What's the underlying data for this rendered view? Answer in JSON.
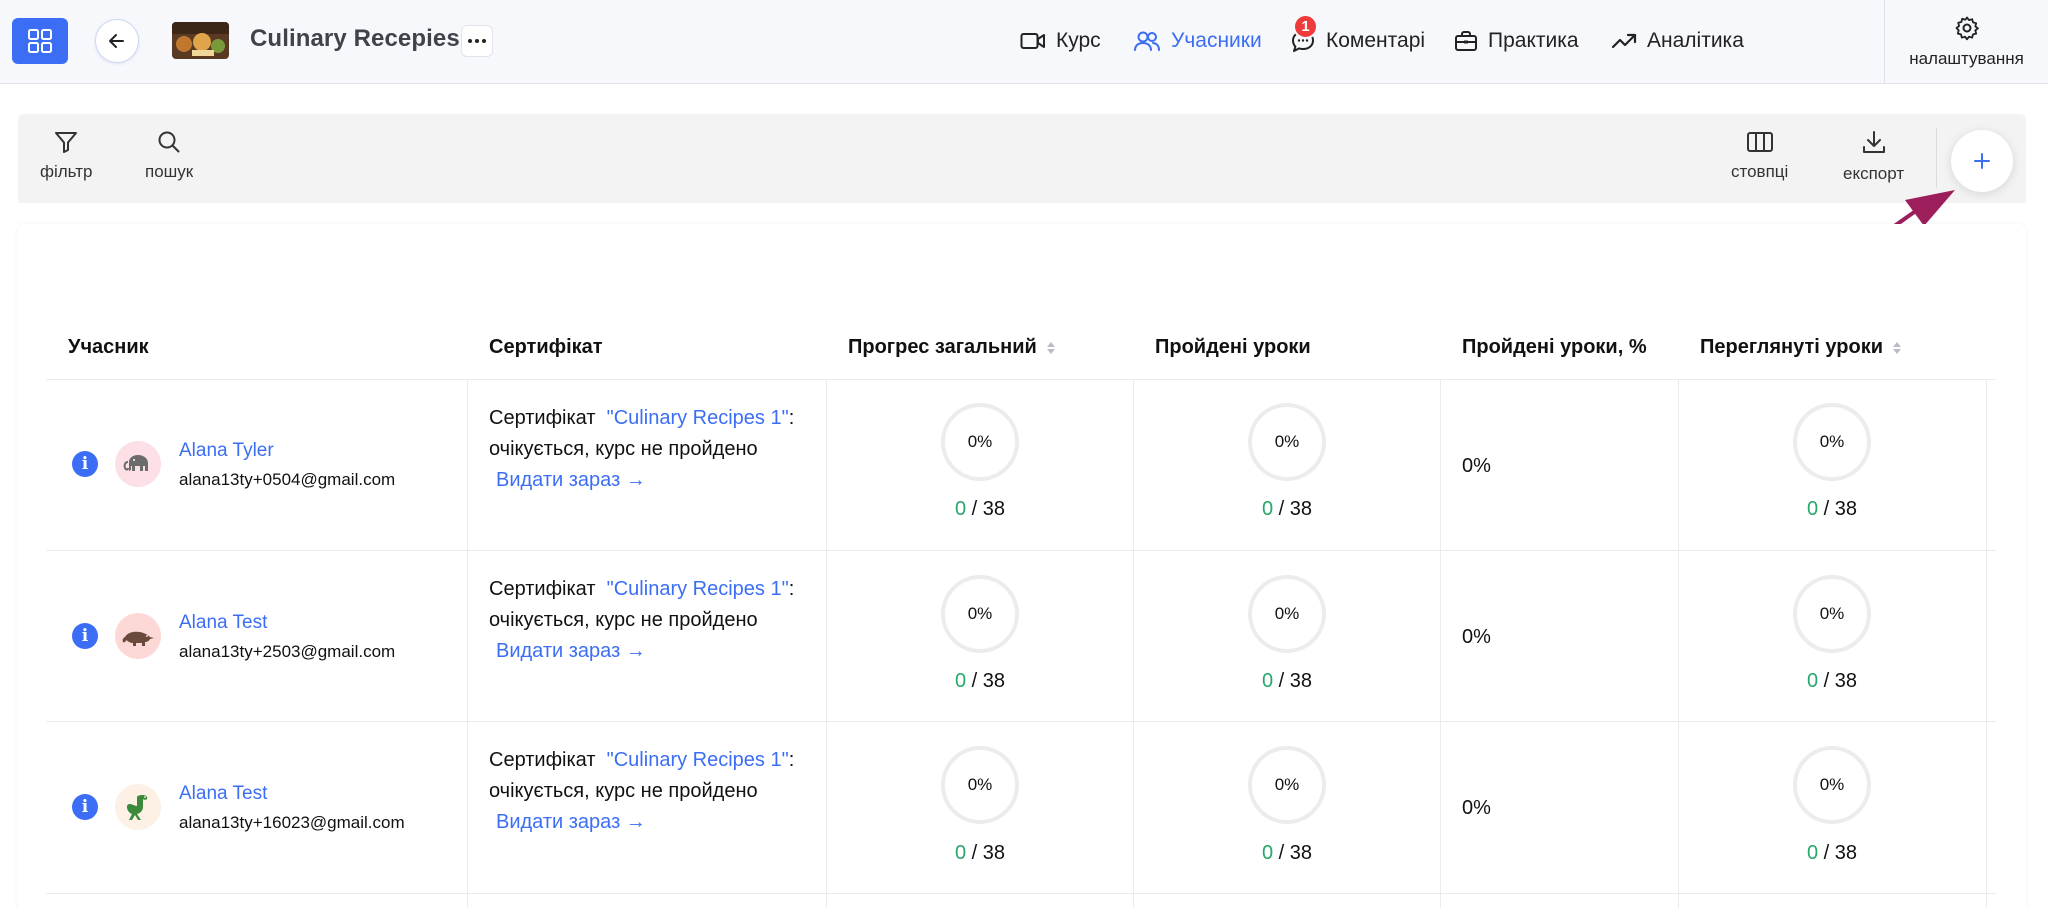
{
  "header": {
    "course_title": "Culinary Recepies",
    "nav": [
      {
        "label": "Курс",
        "icon": "video-camera-icon",
        "active": false
      },
      {
        "label": "Учасники",
        "icon": "users-icon",
        "active": true
      },
      {
        "label": "Коментарі",
        "icon": "comments-icon",
        "active": false,
        "badge": "1"
      },
      {
        "label": "Практика",
        "icon": "briefcase-icon",
        "active": false
      },
      {
        "label": "Аналітика",
        "icon": "trending-up-icon",
        "active": false
      }
    ],
    "settings_label": "налаштування"
  },
  "toolbar": {
    "filter_label": "фільтр",
    "search_label": "пошук",
    "columns_label": "стовпці",
    "export_label": "експорт"
  },
  "table": {
    "columns": [
      "Учасник",
      "Сертифікат",
      "Прогрес загальний",
      "Пройдені уроки",
      "Пройдені уроки, %",
      "Переглянуті уроки"
    ],
    "rows": [
      {
        "name": "Alana Tyler",
        "email": "alana13ty+0504@gmail.com",
        "avatar": "elephant-icon",
        "cert_prefix": "Сертифікат",
        "cert_link": "\"Culinary Recipes 1\"",
        "cert_colon": ":",
        "cert_status": "очікується, курс не пройдено",
        "cert_action": "Видати зараз →",
        "progress_pct": "0%",
        "progress_done": "0",
        "progress_total": "/ 38",
        "lessons_pct": "0%",
        "lessons_done": "0",
        "lessons_total": "/ 38",
        "lessons_percent": "0%",
        "viewed_pct": "0%",
        "viewed_done": "0",
        "viewed_total": "/ 38"
      },
      {
        "name": "Alana Test",
        "email": "alana13ty+2503@gmail.com",
        "avatar": "anteater-icon",
        "cert_prefix": "Сертифікат",
        "cert_link": "\"Culinary Recipes 1\"",
        "cert_colon": ":",
        "cert_status": "очікується, курс не пройдено",
        "cert_action": "Видати зараз →",
        "progress_pct": "0%",
        "progress_done": "0",
        "progress_total": "/ 38",
        "lessons_pct": "0%",
        "lessons_done": "0",
        "lessons_total": "/ 38",
        "lessons_percent": "0%",
        "viewed_pct": "0%",
        "viewed_done": "0",
        "viewed_total": "/ 38"
      },
      {
        "name": "Alana Test",
        "email": "alana13ty+16023@gmail.com",
        "avatar": "dinosaur-icon",
        "cert_prefix": "Сертифікат",
        "cert_link": "\"Culinary Recipes 1\"",
        "cert_colon": ":",
        "cert_status": "очікується, курс не пройдено",
        "cert_action": "Видати зараз →",
        "progress_pct": "0%",
        "progress_done": "0",
        "progress_total": "/ 38",
        "lessons_pct": "0%",
        "lessons_done": "0",
        "lessons_total": "/ 38",
        "lessons_percent": "0%",
        "viewed_pct": "0%",
        "viewed_done": "0",
        "viewed_total": "/ 38"
      }
    ]
  },
  "colors": {
    "accent": "#3b6ef5",
    "badge": "#ef3b3b",
    "success": "#27a86b",
    "annotation_arrow": "#9c1f5c"
  }
}
